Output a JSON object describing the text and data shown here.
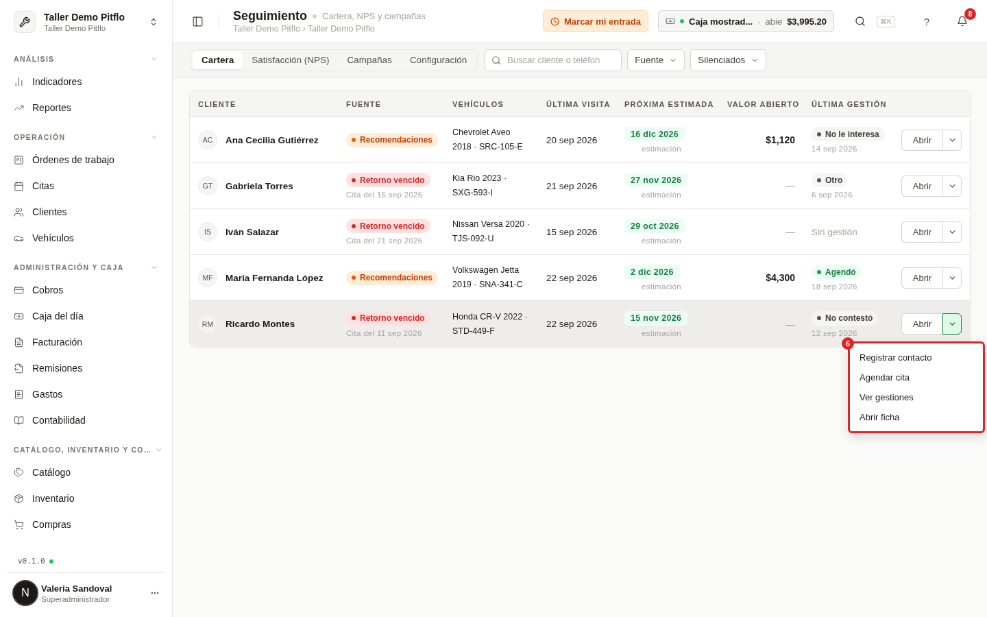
{
  "workspace": {
    "name": "Taller Demo Pitflo",
    "sub": "Taller Demo Pitflo"
  },
  "sidebar": {
    "sections": [
      {
        "title": "ANÁLISIS",
        "expanded": true,
        "items": [
          {
            "label": "Indicadores"
          },
          {
            "label": "Reportes"
          }
        ]
      },
      {
        "title": "OPERACIÓN",
        "expanded": true,
        "items": [
          {
            "label": "Órdenes de trabajo"
          },
          {
            "label": "Citas"
          },
          {
            "label": "Clientes"
          },
          {
            "label": "Vehículos"
          }
        ]
      },
      {
        "title": "ADMINISTRACIÓN Y CAJA",
        "expanded": true,
        "items": [
          {
            "label": "Cobros"
          },
          {
            "label": "Caja del día"
          },
          {
            "label": "Facturación"
          },
          {
            "label": "Remisiones"
          },
          {
            "label": "Gastos"
          },
          {
            "label": "Contabilidad"
          }
        ]
      },
      {
        "title": "CATÁLOGO, INVENTARIO Y CO…",
        "expanded": true,
        "items": [
          {
            "label": "Catálogo"
          },
          {
            "label": "Inventario"
          },
          {
            "label": "Compras"
          }
        ]
      }
    ],
    "version": "v0.1.0",
    "user": {
      "initial": "N",
      "name": "Valeria Sandoval",
      "role": "Superadministrador"
    }
  },
  "header": {
    "title": "Seguimiento",
    "subtitle": "Cartera, NPS y campañas",
    "breadcrumb": "Taller Demo Pitflo › Taller Demo Pitflo",
    "checkin": "Marcar mi entrada",
    "register": {
      "name": "Caja mostrad...",
      "separator": "·",
      "status": "abie",
      "amount": "$3,995.20"
    },
    "shortcut": "⌘K",
    "help": "?",
    "notifications": "8"
  },
  "tabs": [
    {
      "label": "Cartera",
      "selected": true
    },
    {
      "label": "Satisfacción (NPS)",
      "selected": false
    },
    {
      "label": "Campañas",
      "selected": false
    },
    {
      "label": "Configuración",
      "selected": false
    }
  ],
  "search": {
    "placeholder": "Buscar cliente o teléfon"
  },
  "filters": [
    "Fuente",
    "Silenciados"
  ],
  "table": {
    "columns": [
      "CLIENTE",
      "FUENTE",
      "VEHÍCULOS",
      "ÚLTIMA VISITA",
      "PRÓXIMA ESTIMADA",
      "VALOR ABIERTO",
      "ÚLTIMA GESTIÓN"
    ],
    "rows": [
      {
        "initials": "AC",
        "name": "Ana Cecilia Gutiérrez",
        "source": {
          "label": "Recomendaciones",
          "kind": "referral"
        },
        "vehicle": "Chevrolet Aveo 2018 · SRC-105-E",
        "last_visit": "20 sep 2026",
        "next": "16 dic 2026",
        "next_note": "estimación",
        "value": "$1,120",
        "action": {
          "label": "No le interesa",
          "kind": "neutral",
          "date": "14 sep 2026"
        },
        "open": "Abrir",
        "selected": false,
        "menu_open": false
      },
      {
        "initials": "GT",
        "name": "Gabriela Torres",
        "source": {
          "label": "Retorno vencido",
          "kind": "overdue",
          "note": "Cita del 15 sep 2026"
        },
        "vehicle": "Kia Rio 2023 · SXG-593-I",
        "last_visit": "21 sep 2026",
        "next": "27 nov 2026",
        "next_note": "estimación",
        "value": "—",
        "action": {
          "label": "Otro",
          "kind": "neutral",
          "date": "6 sep 2026"
        },
        "open": "Abrir",
        "selected": false,
        "menu_open": false
      },
      {
        "initials": "IS",
        "name": "Iván Salazar",
        "source": {
          "label": "Retorno vencido",
          "kind": "overdue",
          "note": "Cita del 21 sep 2026"
        },
        "vehicle": "Nissan Versa 2020 · TJS-092-U",
        "last_visit": "15 sep 2026",
        "next": "29 oct 2026",
        "next_note": "estimación",
        "value": "—",
        "action": {
          "label": "Sin gestión",
          "kind": "none"
        },
        "open": "Abrir",
        "selected": false,
        "menu_open": false
      },
      {
        "initials": "MF",
        "name": "María Fernanda López",
        "source": {
          "label": "Recomendaciones",
          "kind": "referral"
        },
        "vehicle": "Volkswagen Jetta 2019 · SNA-341-C",
        "last_visit": "22 sep 2026",
        "next": "2 dic 2026",
        "next_note": "estimación",
        "value": "$4,300",
        "action": {
          "label": "Agendó",
          "kind": "positive",
          "date": "18 sep 2026"
        },
        "open": "Abrir",
        "selected": false,
        "menu_open": false
      },
      {
        "initials": "RM",
        "name": "Ricardo Montes",
        "source": {
          "label": "Retorno vencido",
          "kind": "overdue",
          "note": "Cita del 11 sep 2026"
        },
        "vehicle": "Honda CR-V 2022 · STD-449-F",
        "last_visit": "22 sep 2026",
        "next": "15 nov 2026",
        "next_note": "estimación",
        "value": "—",
        "action": {
          "label": "No contestó",
          "kind": "neutral",
          "date": "12 sep 2026"
        },
        "open": "Abrir",
        "selected": true,
        "menu_open": true
      }
    ]
  },
  "row_menu": {
    "marker": "6",
    "items": [
      "Registrar contacto",
      "Agendar cita",
      "Ver gestiones",
      "Abrir ficha"
    ]
  }
}
